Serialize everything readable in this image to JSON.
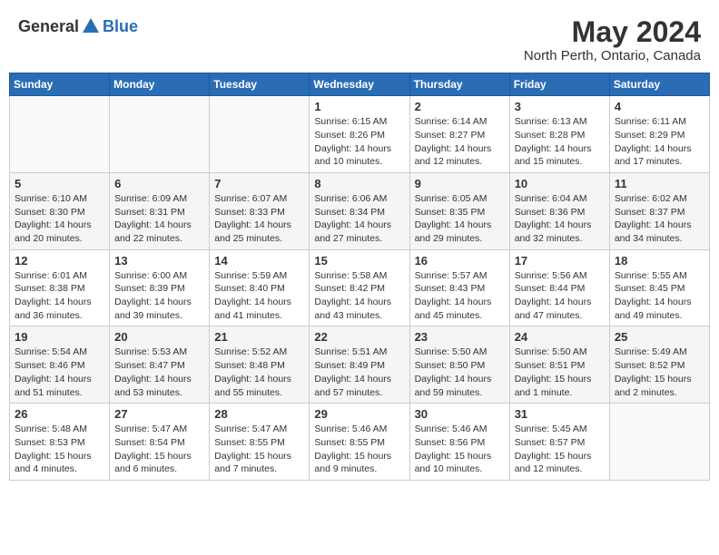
{
  "header": {
    "logo_general": "General",
    "logo_blue": "Blue",
    "title": "May 2024",
    "subtitle": "North Perth, Ontario, Canada"
  },
  "calendar": {
    "headers": [
      "Sunday",
      "Monday",
      "Tuesday",
      "Wednesday",
      "Thursday",
      "Friday",
      "Saturday"
    ],
    "weeks": [
      [
        {
          "day": "",
          "info": ""
        },
        {
          "day": "",
          "info": ""
        },
        {
          "day": "",
          "info": ""
        },
        {
          "day": "1",
          "info": "Sunrise: 6:15 AM\nSunset: 8:26 PM\nDaylight: 14 hours\nand 10 minutes."
        },
        {
          "day": "2",
          "info": "Sunrise: 6:14 AM\nSunset: 8:27 PM\nDaylight: 14 hours\nand 12 minutes."
        },
        {
          "day": "3",
          "info": "Sunrise: 6:13 AM\nSunset: 8:28 PM\nDaylight: 14 hours\nand 15 minutes."
        },
        {
          "day": "4",
          "info": "Sunrise: 6:11 AM\nSunset: 8:29 PM\nDaylight: 14 hours\nand 17 minutes."
        }
      ],
      [
        {
          "day": "5",
          "info": "Sunrise: 6:10 AM\nSunset: 8:30 PM\nDaylight: 14 hours\nand 20 minutes."
        },
        {
          "day": "6",
          "info": "Sunrise: 6:09 AM\nSunset: 8:31 PM\nDaylight: 14 hours\nand 22 minutes."
        },
        {
          "day": "7",
          "info": "Sunrise: 6:07 AM\nSunset: 8:33 PM\nDaylight: 14 hours\nand 25 minutes."
        },
        {
          "day": "8",
          "info": "Sunrise: 6:06 AM\nSunset: 8:34 PM\nDaylight: 14 hours\nand 27 minutes."
        },
        {
          "day": "9",
          "info": "Sunrise: 6:05 AM\nSunset: 8:35 PM\nDaylight: 14 hours\nand 29 minutes."
        },
        {
          "day": "10",
          "info": "Sunrise: 6:04 AM\nSunset: 8:36 PM\nDaylight: 14 hours\nand 32 minutes."
        },
        {
          "day": "11",
          "info": "Sunrise: 6:02 AM\nSunset: 8:37 PM\nDaylight: 14 hours\nand 34 minutes."
        }
      ],
      [
        {
          "day": "12",
          "info": "Sunrise: 6:01 AM\nSunset: 8:38 PM\nDaylight: 14 hours\nand 36 minutes."
        },
        {
          "day": "13",
          "info": "Sunrise: 6:00 AM\nSunset: 8:39 PM\nDaylight: 14 hours\nand 39 minutes."
        },
        {
          "day": "14",
          "info": "Sunrise: 5:59 AM\nSunset: 8:40 PM\nDaylight: 14 hours\nand 41 minutes."
        },
        {
          "day": "15",
          "info": "Sunrise: 5:58 AM\nSunset: 8:42 PM\nDaylight: 14 hours\nand 43 minutes."
        },
        {
          "day": "16",
          "info": "Sunrise: 5:57 AM\nSunset: 8:43 PM\nDaylight: 14 hours\nand 45 minutes."
        },
        {
          "day": "17",
          "info": "Sunrise: 5:56 AM\nSunset: 8:44 PM\nDaylight: 14 hours\nand 47 minutes."
        },
        {
          "day": "18",
          "info": "Sunrise: 5:55 AM\nSunset: 8:45 PM\nDaylight: 14 hours\nand 49 minutes."
        }
      ],
      [
        {
          "day": "19",
          "info": "Sunrise: 5:54 AM\nSunset: 8:46 PM\nDaylight: 14 hours\nand 51 minutes."
        },
        {
          "day": "20",
          "info": "Sunrise: 5:53 AM\nSunset: 8:47 PM\nDaylight: 14 hours\nand 53 minutes."
        },
        {
          "day": "21",
          "info": "Sunrise: 5:52 AM\nSunset: 8:48 PM\nDaylight: 14 hours\nand 55 minutes."
        },
        {
          "day": "22",
          "info": "Sunrise: 5:51 AM\nSunset: 8:49 PM\nDaylight: 14 hours\nand 57 minutes."
        },
        {
          "day": "23",
          "info": "Sunrise: 5:50 AM\nSunset: 8:50 PM\nDaylight: 14 hours\nand 59 minutes."
        },
        {
          "day": "24",
          "info": "Sunrise: 5:50 AM\nSunset: 8:51 PM\nDaylight: 15 hours\nand 1 minute."
        },
        {
          "day": "25",
          "info": "Sunrise: 5:49 AM\nSunset: 8:52 PM\nDaylight: 15 hours\nand 2 minutes."
        }
      ],
      [
        {
          "day": "26",
          "info": "Sunrise: 5:48 AM\nSunset: 8:53 PM\nDaylight: 15 hours\nand 4 minutes."
        },
        {
          "day": "27",
          "info": "Sunrise: 5:47 AM\nSunset: 8:54 PM\nDaylight: 15 hours\nand 6 minutes."
        },
        {
          "day": "28",
          "info": "Sunrise: 5:47 AM\nSunset: 8:55 PM\nDaylight: 15 hours\nand 7 minutes."
        },
        {
          "day": "29",
          "info": "Sunrise: 5:46 AM\nSunset: 8:55 PM\nDaylight: 15 hours\nand 9 minutes."
        },
        {
          "day": "30",
          "info": "Sunrise: 5:46 AM\nSunset: 8:56 PM\nDaylight: 15 hours\nand 10 minutes."
        },
        {
          "day": "31",
          "info": "Sunrise: 5:45 AM\nSunset: 8:57 PM\nDaylight: 15 hours\nand 12 minutes."
        },
        {
          "day": "",
          "info": ""
        }
      ]
    ]
  }
}
